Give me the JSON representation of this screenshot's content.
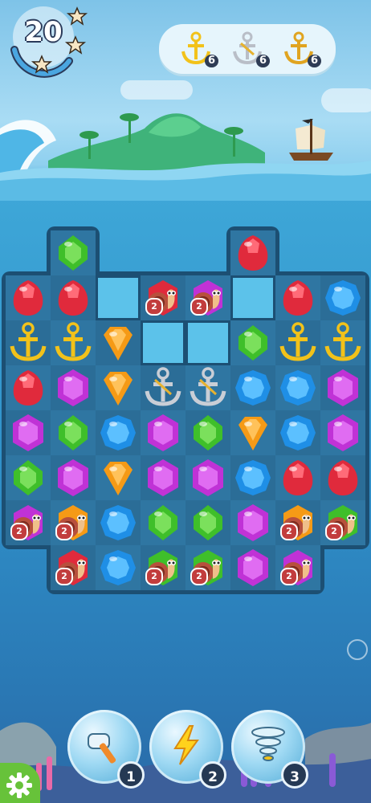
{
  "hud": {
    "moves_left": "20",
    "goals": [
      {
        "icon": "gold-anchor-icon",
        "count": "6"
      },
      {
        "icon": "silver-anchor-icon",
        "count": "6"
      },
      {
        "icon": "bronze-anchor-icon",
        "count": "6"
      }
    ]
  },
  "colors": {
    "red": "#e02a3c",
    "green": "#3fbf2a",
    "blue": "#1f8fe6",
    "purple": "#c032d6",
    "orange": "#f59a16",
    "anchor_gold": "#f2c21a",
    "anchor_silver": "#c9ced6"
  },
  "board": {
    "columns": 8,
    "rows": 7,
    "rows_data": [
      [
        "none",
        "green",
        "none",
        "none",
        "none",
        "red",
        "none",
        "none"
      ],
      [
        "red",
        "red",
        "hole",
        "snail-red-2",
        "snail-purple-2",
        "hole",
        "red",
        "blue"
      ],
      [
        "anchor-gold",
        "anchor-gold",
        "orange",
        "hole",
        "hole",
        "green",
        "anchor-gold",
        "anchor-gold"
      ],
      [
        "red",
        "purple",
        "orange",
        "anchor-silver",
        "anchor-silver",
        "blue",
        "blue",
        "purple"
      ],
      [
        "purple",
        "green",
        "blue",
        "purple",
        "green",
        "orange",
        "blue",
        "purple"
      ],
      [
        "green",
        "purple",
        "orange",
        "purple",
        "purple",
        "blue",
        "red",
        "red"
      ],
      [
        "snail-purple-2",
        "snail-orange-2",
        "blue",
        "green",
        "green",
        "purple",
        "snail-orange-2",
        "snail-green-2"
      ],
      [
        "none",
        "snail-red-2",
        "blue",
        "snail-green-2",
        "snail-green-2",
        "purple",
        "snail-purple-2",
        "none"
      ]
    ]
  },
  "boosters": [
    {
      "name": "hammer",
      "icon": "hammer-icon",
      "count": "1"
    },
    {
      "name": "lightning",
      "icon": "lightning-icon",
      "count": "2"
    },
    {
      "name": "tornado",
      "icon": "tornado-icon",
      "count": "3"
    }
  ],
  "settings": {
    "icon": "gear-icon"
  }
}
